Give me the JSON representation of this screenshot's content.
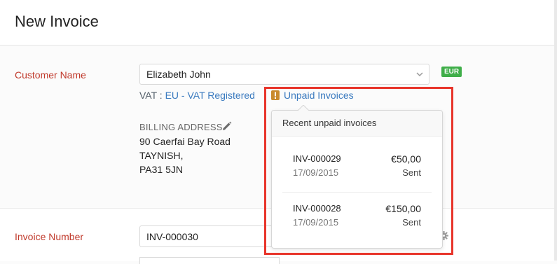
{
  "page": {
    "title": "New Invoice"
  },
  "customer": {
    "label": "Customer Name",
    "value": "Elizabeth John",
    "currency_badge": "EUR",
    "vat_prefix": "VAT :",
    "vat_value": "EU - VAT Registered",
    "unpaid_link": "Unpaid Invoices"
  },
  "billing": {
    "label": "BILLING ADDRESS",
    "lines": [
      "90 Caerfai Bay Road",
      "TAYNISH,",
      "PA31 5JN"
    ]
  },
  "unpaid_popover": {
    "title": "Recent unpaid invoices",
    "invoices": [
      {
        "number": "INV-000029",
        "date": "17/09/2015",
        "amount": "€50,00",
        "status": "Sent"
      },
      {
        "number": "INV-000028",
        "date": "17/09/2015",
        "amount": "€150,00",
        "status": "Sent"
      }
    ]
  },
  "invoice_number": {
    "label": "Invoice Number",
    "value": "INV-000030"
  },
  "icons": {
    "dropdown": "chevron-down-icon",
    "edit": "pencil-icon",
    "warning": "warning-icon",
    "settings": "gear-icon"
  },
  "colors": {
    "label_red": "#c0392b",
    "link_blue": "#3a7abf",
    "badge_green": "#3fae49",
    "highlight_red": "#e8352b",
    "warning_amber": "#c98a2c"
  }
}
